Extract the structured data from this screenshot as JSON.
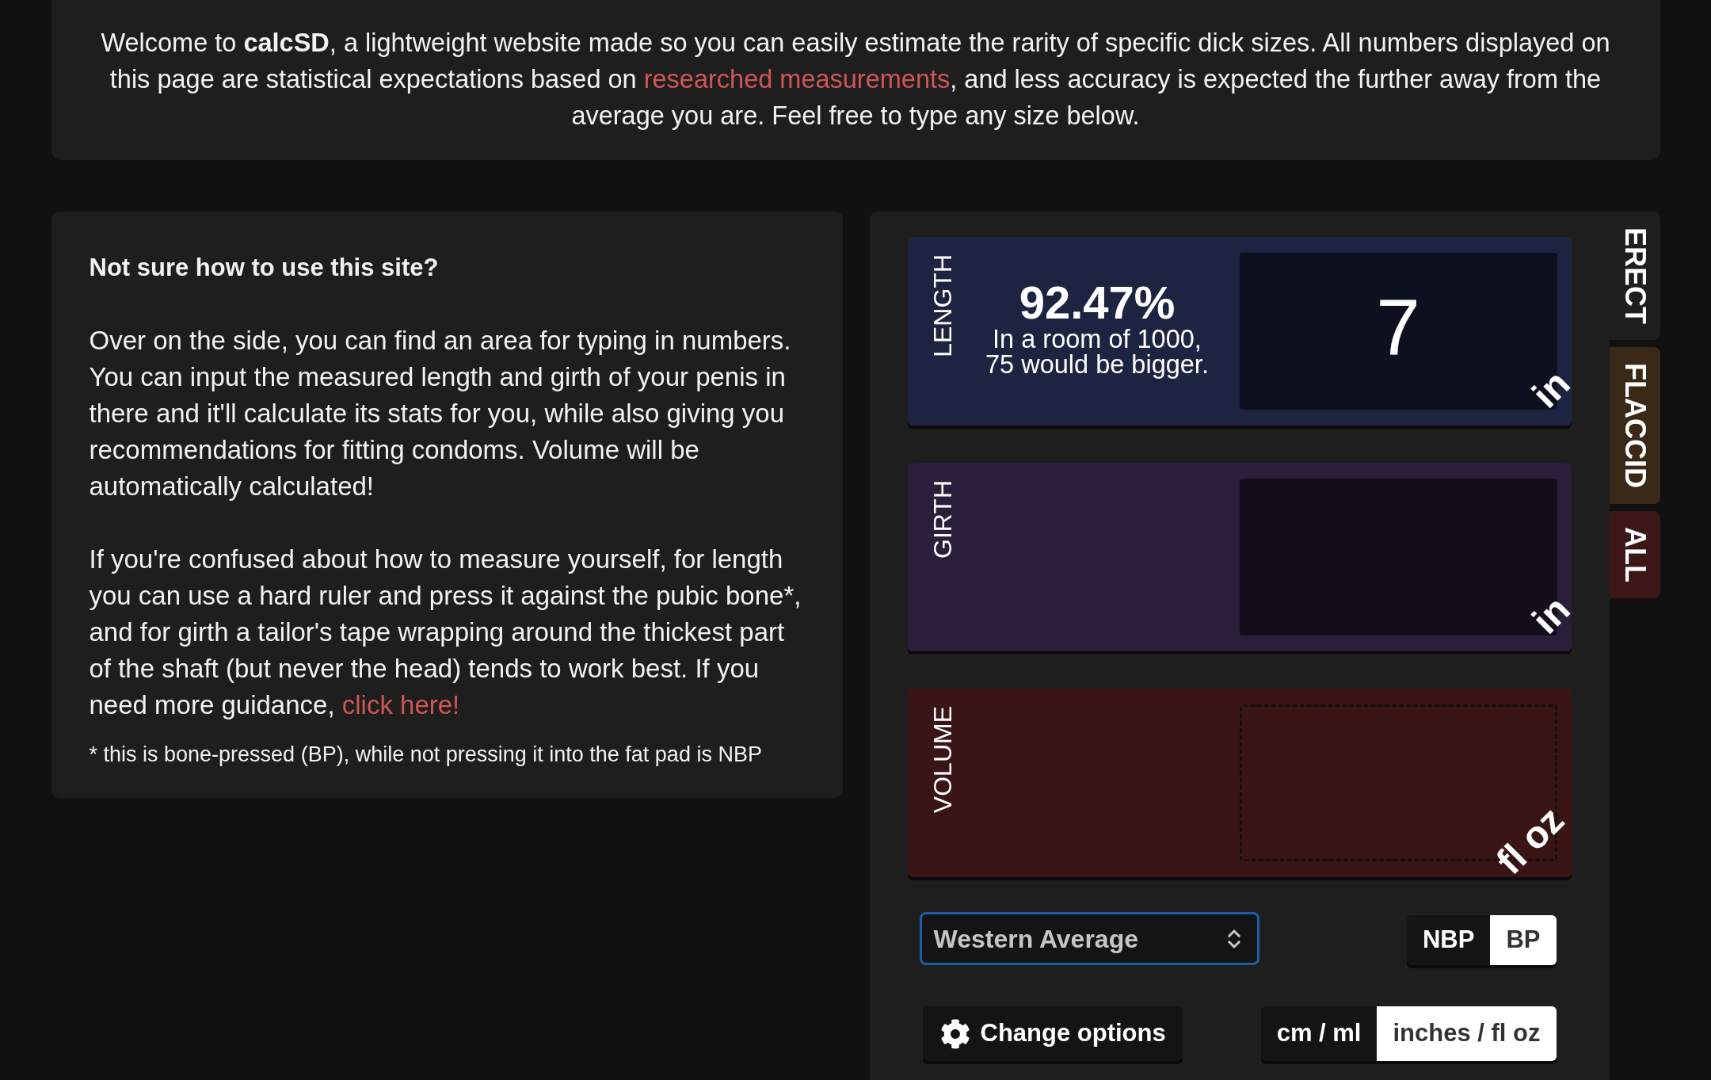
{
  "intro": {
    "text": "Welcome to **calcSD**, a lightweight website made so you can easily estimate the rarity of specific dick sizes. All numbers displayed on this page are statistical expectations based on",
    "link": "researched measurements",
    "text_after": ", and less accuracy is expected the further away from the average you are. Feel free to type any size below."
  },
  "help": {
    "title": "Not sure how to use this site?",
    "paragraphs": [
      {
        "text": "Over on the side, you can find an area for typing in numbers. You can input the measured length and girth of your penis in there and it'll calculate its stats for you, while also giving you recommendations for fitting condoms. Volume will be automatically calculated!"
      },
      {
        "text": "If you're confused about how to measure yourself, for length you can use a hard ruler and press it against the pubic bone*, and for girth a tailor's tape wrapping around the thickest part of the shaft (but never the head) tends to work best. If you need more guidance,",
        "link": "click here!"
      }
    ],
    "footnote": "* this is bone-pressed (BP), while not pressing it into the fat pad is NBP"
  },
  "calculator": {
    "tabs": [
      {
        "label": "ERECT",
        "selected": true
      },
      {
        "label": "FLACCID",
        "selected": false,
        "color": "#3b2917"
      },
      {
        "label": "ALL",
        "selected": false,
        "color": "#3d1717"
      }
    ],
    "cards": [
      {
        "kind": "input",
        "label": "LENGTH",
        "color": "#1d2442",
        "percentile": "92.47%",
        "description": [
          "In a room of 1000,",
          "75 would be bigger."
        ],
        "value": "7",
        "unit": "in"
      },
      {
        "kind": "input",
        "label": "GIRTH",
        "color": "#2b1e3a",
        "unit": "in"
      },
      {
        "kind": "calculated",
        "label": "VOLUME",
        "color": "#3a1515",
        "unit": "fl oz"
      }
    ],
    "population_select": {
      "value": "Western Average",
      "focused": true
    },
    "pressing_toggle": [
      {
        "label": "NBP",
        "selected": false
      },
      {
        "label": "BP",
        "selected": true
      }
    ],
    "options_button": {
      "label": "Change options"
    },
    "unit_toggle": [
      {
        "label": "cm / ml",
        "selected": false
      },
      {
        "label": "inches / fl oz",
        "selected": true
      }
    ]
  }
}
